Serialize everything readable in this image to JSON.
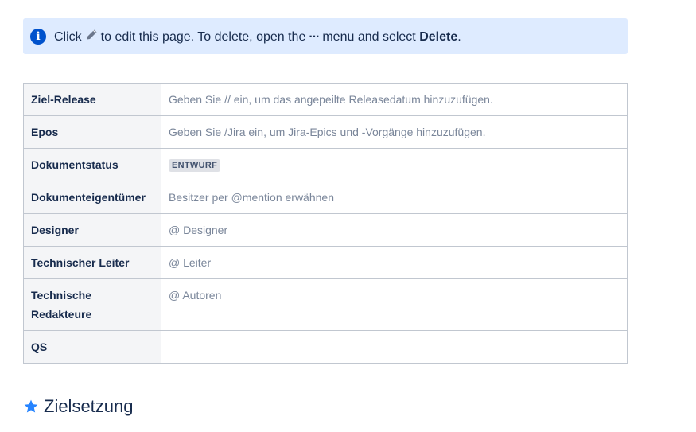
{
  "info_panel": {
    "icon": "info-icon",
    "text_click": "Click",
    "text_edit": "to edit this page. To delete, open the",
    "text_menu": "menu and select",
    "text_delete": "Delete",
    "text_end": ".",
    "colors": {
      "background": "#deebff",
      "icon": "#0052cc"
    }
  },
  "properties_table": {
    "rows": [
      {
        "label": "Ziel-Release",
        "value": "Geben Sie // ein, um das angepeilte Releasedatum hinzuzufügen."
      },
      {
        "label": "Epos",
        "value": "Geben Sie /Jira ein, um Jira-Epics und -Vorgänge hinzuzufügen."
      },
      {
        "label": "Dokumentstatus",
        "status": "ENTWURF"
      },
      {
        "label": "Dokumenteigentümer",
        "value": "Besitzer per @mention erwähnen"
      },
      {
        "label": "Designer",
        "value": "@ Designer"
      },
      {
        "label": "Technischer Leiter",
        "value": "@ Leiter"
      },
      {
        "label": "Technische Redakteure",
        "value": "@ Autoren"
      },
      {
        "label": "QS",
        "value": ""
      }
    ]
  },
  "section_heading": {
    "icon": "star-icon",
    "text": "Zielsetzung"
  }
}
